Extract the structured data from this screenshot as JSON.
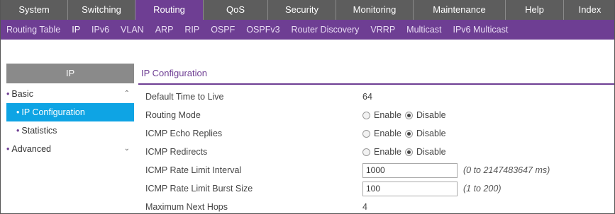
{
  "top_nav": {
    "items": [
      {
        "label": "System",
        "active": false
      },
      {
        "label": "Switching",
        "active": false
      },
      {
        "label": "Routing",
        "active": true
      },
      {
        "label": "QoS",
        "active": false
      },
      {
        "label": "Security",
        "active": false
      },
      {
        "label": "Monitoring",
        "active": false
      },
      {
        "label": "Maintenance",
        "active": false
      },
      {
        "label": "Help",
        "active": false
      },
      {
        "label": "Index",
        "active": false
      }
    ]
  },
  "sub_nav": {
    "items": [
      {
        "label": "Routing Table",
        "active": false
      },
      {
        "label": "IP",
        "active": true
      },
      {
        "label": "IPv6",
        "active": false
      },
      {
        "label": "VLAN",
        "active": false
      },
      {
        "label": "ARP",
        "active": false
      },
      {
        "label": "RIP",
        "active": false
      },
      {
        "label": "OSPF",
        "active": false
      },
      {
        "label": "OSPFv3",
        "active": false
      },
      {
        "label": "Router Discovery",
        "active": false
      },
      {
        "label": "VRRP",
        "active": false
      },
      {
        "label": "Multicast",
        "active": false
      },
      {
        "label": "IPv6 Multicast",
        "active": false
      }
    ]
  },
  "sidebar": {
    "title": "IP",
    "bullet": "•",
    "items": {
      "basic": {
        "label": "Basic",
        "expanded": true
      },
      "ip_configuration": {
        "label": "IP Configuration",
        "selected": true
      },
      "statistics": {
        "label": "Statistics"
      },
      "advanced": {
        "label": "Advanced",
        "expanded": false
      }
    },
    "chevron_up": "⌃",
    "chevron_down": "⌄"
  },
  "panel": {
    "title": "IP Configuration",
    "rows": {
      "ttl": {
        "label": "Default Time to Live",
        "value": "64"
      },
      "routing_mode": {
        "label": "Routing Mode",
        "enable": "Enable",
        "disable": "Disable",
        "selected": "Disable"
      },
      "icmp_echo": {
        "label": "ICMP Echo Replies",
        "enable": "Enable",
        "disable": "Disable",
        "selected": "Disable"
      },
      "icmp_redirects": {
        "label": "ICMP Redirects",
        "enable": "Enable",
        "disable": "Disable",
        "selected": "Disable"
      },
      "rate_interval": {
        "label": "ICMP Rate Limit Interval",
        "value": "1000",
        "hint": "(0 to 2147483647 ms)"
      },
      "rate_burst": {
        "label": "ICMP Rate Limit Burst Size",
        "value": "100",
        "hint": "(1 to 200)"
      },
      "max_hops": {
        "label": "Maximum Next Hops",
        "value": "4"
      }
    }
  },
  "colors": {
    "accent": "#6e3e93",
    "selected": "#0ea4e4",
    "topnav_bg": "#5d5d5d"
  }
}
